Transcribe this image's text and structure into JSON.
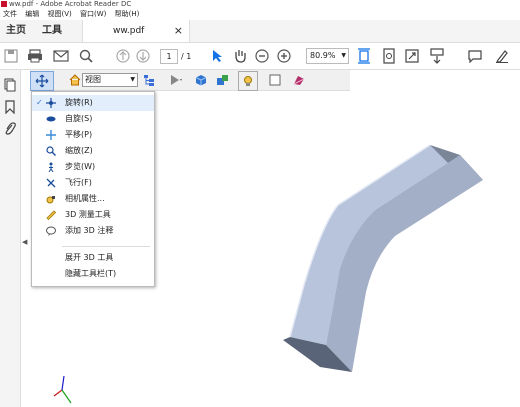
{
  "window": {
    "title": "ww.pdf - Adobe Acrobat Reader DC"
  },
  "menubar": {
    "items": [
      "文件",
      "编辑",
      "视图(V)",
      "窗口(W)",
      "帮助(H)"
    ]
  },
  "tabs": {
    "home": "主页",
    "tools": "工具",
    "document": "ww.pdf"
  },
  "toolbar": {
    "page_current": "1",
    "page_total": "/ 1",
    "zoom": "80.9%"
  },
  "toolbar_3d": {
    "view_select": "视图"
  },
  "tool_menu": {
    "items": [
      {
        "label": "旋转(R)",
        "checked": true,
        "icon": "rotate-icon"
      },
      {
        "label": "自旋(S)",
        "icon": "spin-icon"
      },
      {
        "label": "平移(P)",
        "icon": "pan-icon"
      },
      {
        "label": "缩放(Z)",
        "icon": "zoom-icon"
      },
      {
        "label": "步览(W)",
        "icon": "walk-icon"
      },
      {
        "label": "飞行(F)",
        "icon": "fly-icon"
      },
      {
        "label": "相机属性...",
        "icon": "camera-properties-icon"
      },
      {
        "label": "3D 测量工具",
        "icon": "measure-icon"
      },
      {
        "label": "添加 3D 注释",
        "icon": "comment-3d-icon"
      }
    ],
    "extra": [
      {
        "label": "展开 3D 工具"
      },
      {
        "label": "隐藏工具栏(T)"
      }
    ]
  },
  "colors": {
    "accent": "#1473e6",
    "menu_highlight": "#e3eefc",
    "model_light": "#b8c4dc",
    "model_dark": "#5a6478"
  }
}
